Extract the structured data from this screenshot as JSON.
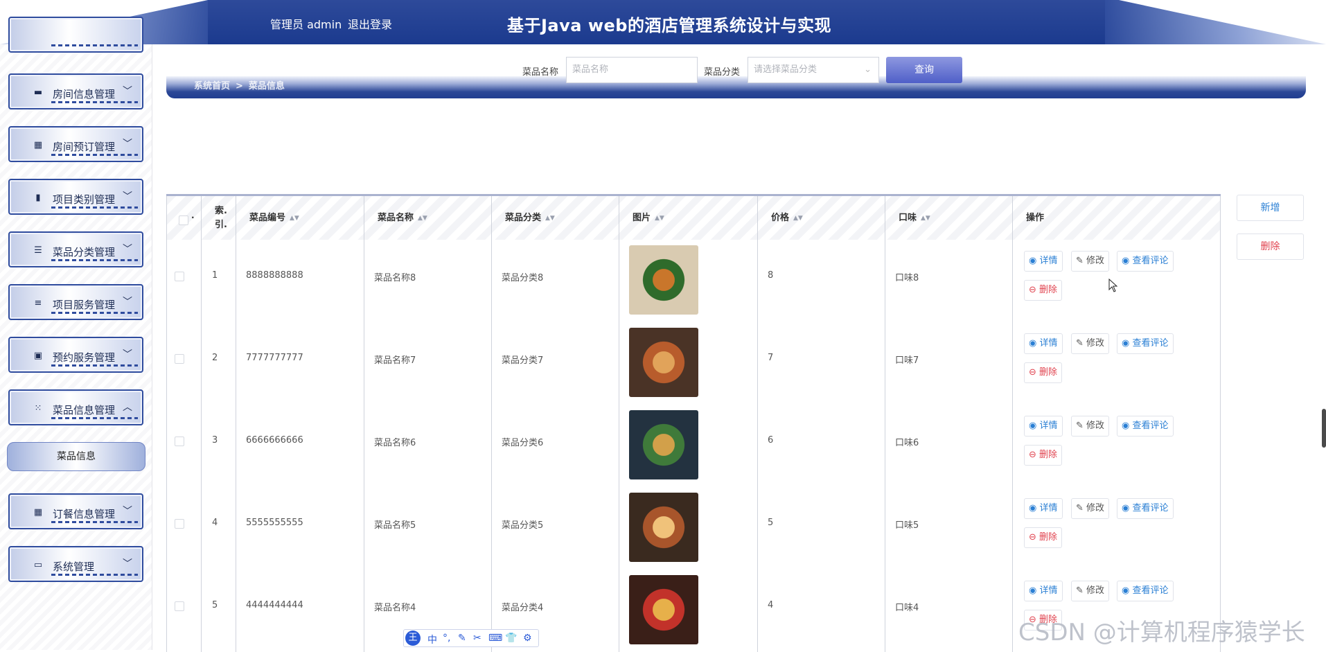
{
  "header": {
    "user": "管理员 admin",
    "logout": "退出登录",
    "title": "基于Java web的酒店管理系统设计与实现"
  },
  "sidebar": {
    "items": [
      {
        "label": "房间信息管理",
        "icon": "chat-icon",
        "chevron": "﹀"
      },
      {
        "label": "房间预订管理",
        "icon": "grid-icon",
        "chevron": "﹀"
      },
      {
        "label": "项目类别管理",
        "icon": "bar-chart-icon",
        "chevron": "﹀"
      },
      {
        "label": "菜品分类管理",
        "icon": "sliders-icon",
        "chevron": "﹀"
      },
      {
        "label": "项目服务管理",
        "icon": "list-icon",
        "chevron": "﹀"
      },
      {
        "label": "预约服务管理",
        "icon": "clipboard-icon",
        "chevron": "﹀"
      },
      {
        "label": "菜品信息管理",
        "icon": "apps-icon",
        "chevron": "︿"
      },
      {
        "label": "订餐信息管理",
        "icon": "grid-icon",
        "chevron": "﹀"
      },
      {
        "label": "系统管理",
        "icon": "monitor-icon",
        "chevron": "﹀"
      }
    ],
    "submenu": "菜品信息"
  },
  "breadcrumb": {
    "home": "系统首页",
    "sep": ">",
    "current": "菜品信息"
  },
  "search": {
    "name_label": "菜品名称",
    "name_placeholder": "菜品名称",
    "category_label": "菜品分类",
    "category_placeholder": "请选择菜品分类",
    "query": "查询"
  },
  "actions": {
    "add": "新增",
    "delete": "删除"
  },
  "table": {
    "headers": [
      "索.\n引.",
      "菜品编号",
      "菜品名称",
      "菜品分类",
      "图片",
      "价格",
      "口味",
      "操作"
    ],
    "check_dot": "·",
    "rows": [
      {
        "index": "1",
        "code": "8888888888",
        "name": "菜品名称8",
        "category": "菜品分类8",
        "price": "8",
        "taste": "口味8"
      },
      {
        "index": "2",
        "code": "7777777777",
        "name": "菜品名称7",
        "category": "菜品分类7",
        "price": "7",
        "taste": "口味7"
      },
      {
        "index": "3",
        "code": "6666666666",
        "name": "菜品名称6",
        "category": "菜品分类6",
        "price": "6",
        "taste": "口味6"
      },
      {
        "index": "4",
        "code": "5555555555",
        "name": "菜品名称5",
        "category": "菜品分类5",
        "price": "5",
        "taste": "口味5"
      },
      {
        "index": "5",
        "code": "4444444444",
        "name": "菜品名称4",
        "category": "菜品分类4",
        "price": "4",
        "taste": "口味4"
      }
    ],
    "ops": {
      "detail": "详情",
      "edit": "修改",
      "comments": "查看评论",
      "delete": "删除"
    }
  },
  "ime_toolbar": [
    "中",
    "°,",
    "✎",
    "✂",
    "⌨",
    "👕",
    "⚙"
  ],
  "watermark": "CSDN @计算机程序猿学长",
  "colors": {
    "primary": "#1b3a8e",
    "link": "#2a7fd4",
    "danger": "#e0434f"
  }
}
